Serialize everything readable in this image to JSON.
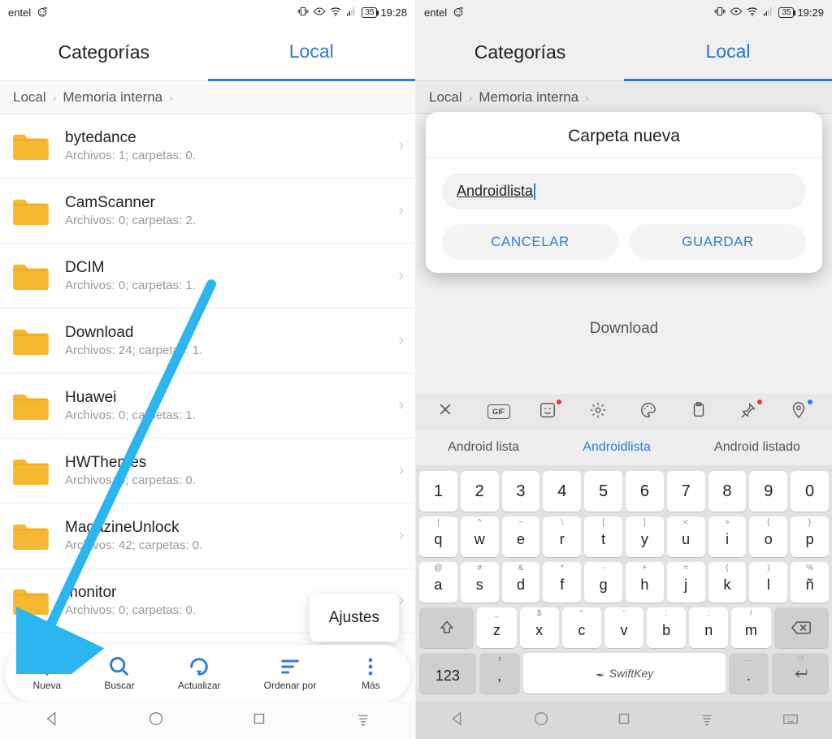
{
  "left": {
    "status": {
      "carrier": "entel",
      "battery": "35",
      "time": "19:28"
    },
    "tabs": {
      "categories": "Categorías",
      "local": "Local"
    },
    "breadcrumb": [
      "Local",
      "Memoria interna"
    ],
    "folders": [
      {
        "name": "bytedance",
        "sub": "Archivos: 1; carpetas: 0."
      },
      {
        "name": "CamScanner",
        "sub": "Archivos: 0; carpetas: 2."
      },
      {
        "name": "DCIM",
        "sub": "Archivos: 0; carpetas: 1."
      },
      {
        "name": "Download",
        "sub": "Archivos: 24; carpetas: 1."
      },
      {
        "name": "Huawei",
        "sub": "Archivos: 0; carpetas: 1."
      },
      {
        "name": "HWThemes",
        "sub": "Archivos: 0; carpetas: 0."
      },
      {
        "name": "MagazineUnlock",
        "sub": "Archivos: 42; carpetas: 0."
      },
      {
        "name": "monitor",
        "sub": "Archivos: 0; carpetas: 0."
      }
    ],
    "popup": "Ajustes",
    "bottom": {
      "nueva": "Nueva",
      "buscar": "Buscar",
      "actualizar": "Actualizar",
      "ordenar": "Ordenar por",
      "mas": "Más"
    }
  },
  "right": {
    "status": {
      "carrier": "entel",
      "battery": "35",
      "time": "19:29"
    },
    "tabs": {
      "categories": "Categorías",
      "local": "Local"
    },
    "breadcrumb": [
      "Local",
      "Memoria interna"
    ],
    "dialog": {
      "title": "Carpeta nueva",
      "value": "Androidlista",
      "cancel": "CANCELAR",
      "save": "GUARDAR"
    },
    "partial_row": "Download",
    "suggestions": [
      "Android lista",
      "Androidlista",
      "Android listado"
    ],
    "keyboard": {
      "numbers": [
        "1",
        "2",
        "3",
        "4",
        "5",
        "6",
        "7",
        "8",
        "9",
        "0"
      ],
      "row1": [
        {
          "h": "|",
          "m": "q"
        },
        {
          "h": "^",
          "m": "w"
        },
        {
          "h": "~",
          "m": "e"
        },
        {
          "h": "\\",
          "m": "r"
        },
        {
          "h": "[",
          "m": "t"
        },
        {
          "h": "]",
          "m": "y"
        },
        {
          "h": "<",
          "m": "u"
        },
        {
          "h": ">",
          "m": "i"
        },
        {
          "h": "{",
          "m": "o"
        },
        {
          "h": "}",
          "m": "p"
        }
      ],
      "row2": [
        {
          "h": "@",
          "m": "a"
        },
        {
          "h": "#",
          "m": "s"
        },
        {
          "h": "&",
          "m": "d"
        },
        {
          "h": "*",
          "m": "f"
        },
        {
          "h": "-",
          "m": "g"
        },
        {
          "h": "+",
          "m": "h"
        },
        {
          "h": "=",
          "m": "j"
        },
        {
          "h": "(",
          "m": "k"
        },
        {
          "h": ")",
          "m": "l"
        },
        {
          "h": "%",
          "m": "ñ"
        }
      ],
      "row3": [
        {
          "h": "_",
          "m": "z"
        },
        {
          "h": "$",
          "m": "x"
        },
        {
          "h": "\"",
          "m": "c"
        },
        {
          "h": "'",
          "m": "v"
        },
        {
          "h": ":",
          "m": "b"
        },
        {
          "h": ";",
          "m": "n"
        },
        {
          "h": "/",
          "m": "m"
        }
      ],
      "mode": "123",
      "brand": "SwiftKey"
    }
  }
}
